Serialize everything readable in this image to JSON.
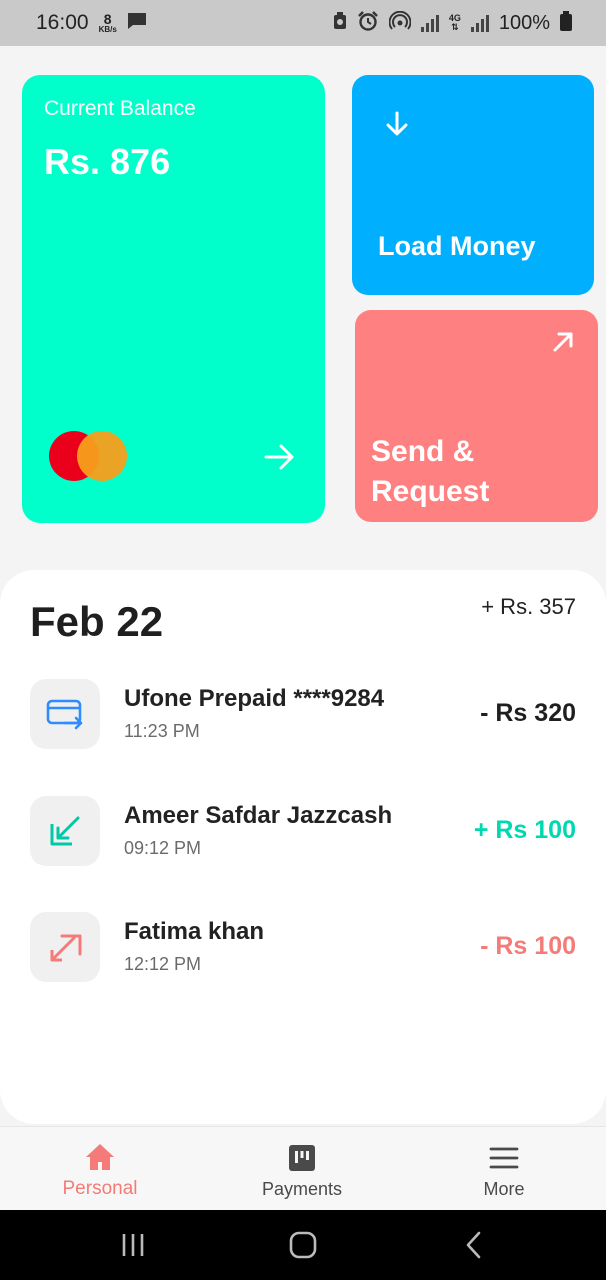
{
  "status_bar": {
    "time": "16:00",
    "data_speed_value": "8",
    "data_speed_unit": "KB/s",
    "network_type": "4G",
    "battery": "100%",
    "icons": [
      "chat-icon",
      "battery-saver-icon",
      "alarm-icon",
      "hotspot-icon",
      "signal-icon",
      "battery-icon"
    ]
  },
  "balance_card": {
    "label": "Current Balance",
    "amount": "Rs. 876",
    "card_brand_icon": "mastercard-logo",
    "color": "#00ffca"
  },
  "load_card": {
    "label": "Load Money",
    "icon": "arrow-down-icon",
    "color": "#00b0ff"
  },
  "send_card": {
    "label": "Send &\nRequest",
    "icon": "arrow-up-right-icon",
    "color": "#ff8080"
  },
  "transactions": {
    "date": "Feb 22",
    "day_total": "+ Rs. 357",
    "items": [
      {
        "name": "Ufone Prepaid ****9284",
        "time": "11:23 PM",
        "amount": "- Rs 320",
        "icon": "card-transfer-icon",
        "amount_color": "#1f1f1f"
      },
      {
        "name": "Ameer Safdar Jazzcash",
        "time": "09:12 PM",
        "amount": "+ Rs 100",
        "icon": "received-icon",
        "amount_color": "#00d8b0"
      },
      {
        "name": "Fatima khan",
        "time": "12:12 PM",
        "amount": "- Rs 100",
        "icon": "sent-icon",
        "amount_color": "#f47b77"
      }
    ]
  },
  "bottom_nav": {
    "items": [
      {
        "label": "Personal",
        "icon": "home-icon",
        "active": true
      },
      {
        "label": "Payments",
        "icon": "payments-icon",
        "active": false
      },
      {
        "label": "More",
        "icon": "menu-icon",
        "active": false
      }
    ],
    "active_color": "#f47b77"
  },
  "system_nav": {
    "icons": [
      "recents-icon",
      "home-button-icon",
      "back-icon"
    ]
  }
}
